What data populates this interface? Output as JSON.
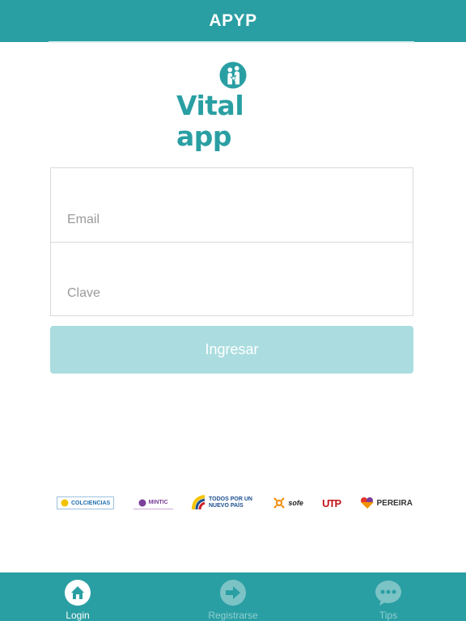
{
  "header": {
    "title": "APYP"
  },
  "logo": {
    "text": "Vital app",
    "icon": "family-heart-icon"
  },
  "form": {
    "email_placeholder": "Email",
    "password_placeholder": "Clave"
  },
  "login_button": {
    "label": "Ingresar"
  },
  "sponsors": [
    {
      "name": "COLCIENCIAS",
      "color": "#1c6fb0"
    },
    {
      "name": "MINTIC",
      "color": "#7b3f9b"
    },
    {
      "name": "TODOS POR UN NUEVO PAÍS",
      "color": "#1d4f91"
    },
    {
      "name": "sofe",
      "color": "#f08a00"
    },
    {
      "name": "UTP",
      "color": "#c4161c"
    },
    {
      "name": "PEREIRA",
      "color": "#333333"
    }
  ],
  "tabs": [
    {
      "label": "Login",
      "icon": "home-icon",
      "active": true
    },
    {
      "label": "Registrarse",
      "icon": "arrow-right-icon",
      "active": false
    },
    {
      "label": "Tips",
      "icon": "chat-bubble-icon",
      "active": false
    }
  ],
  "colors": {
    "primary": "#2a9fa3",
    "button_disabled": "#abdde0"
  }
}
